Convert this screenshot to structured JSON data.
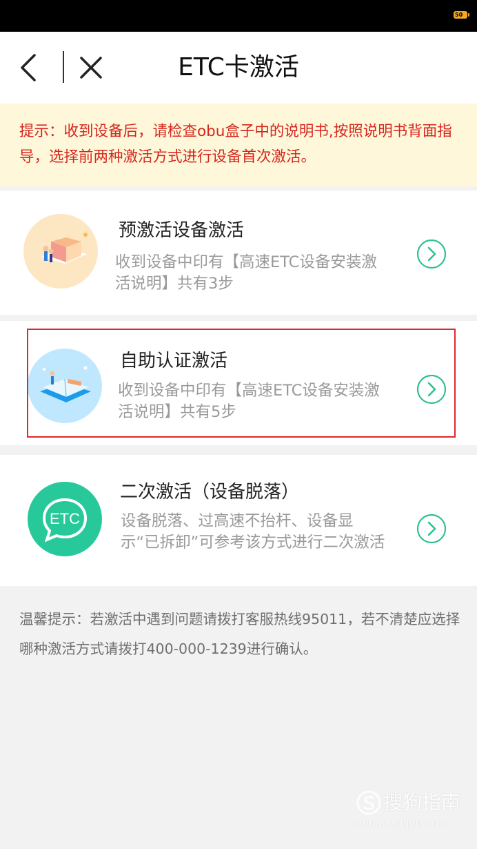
{
  "status_bar": {
    "battery_level": "50"
  },
  "header": {
    "title": "ETC卡激活"
  },
  "notice": {
    "text": "提示：收到设备后，请检查obu盒子中的说明书,按照说明书背面指导，选择前两种激活方式进行设备首次激活。"
  },
  "options": [
    {
      "title": "预激活设备激活",
      "desc": "收到设备中印有【高速ETC设备安装激活说明】共有3步"
    },
    {
      "title": "自助认证激活",
      "desc": "收到设备中印有【高速ETC设备安装激活说明】共有5步"
    },
    {
      "title": "二次激活（设备脱落）",
      "desc": "设备脱落、过高速不抬杆、设备显示“已拆卸”可参考该方式进行二次激活",
      "icon_text": "ETC"
    }
  ],
  "tip": {
    "text": "温馨提示：若激活中遇到问题请拨打客服热线95011，若不清楚应选择哪种激活方式请拨打400-000-1239进行确认。"
  },
  "watermark": {
    "brand": "搜狗指南",
    "url": "zhinan.sogou.com"
  },
  "colors": {
    "notice_bg": "#fff7da",
    "notice_text": "#d4271d",
    "accent_green": "#2fc18f",
    "highlight_border": "#e0272b"
  },
  "icons": {
    "back": "back-arrow-icon",
    "close": "close-icon",
    "chevron": "chevron-right-circle-icon"
  }
}
